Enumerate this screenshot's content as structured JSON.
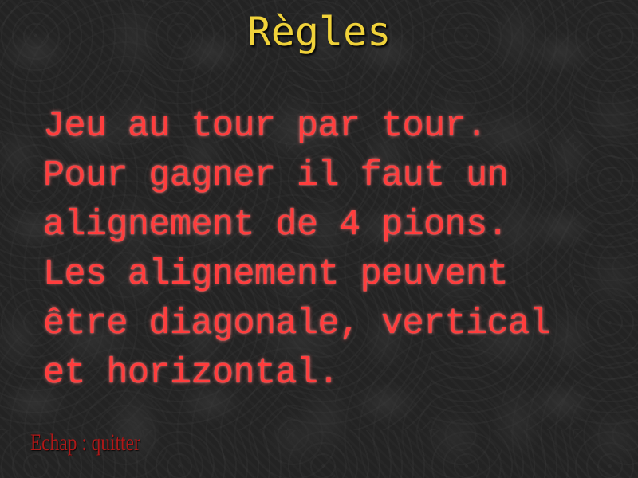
{
  "screen": {
    "title": "Règles",
    "lines": [
      "Jeu au tour par tour.",
      "Pour gagner il faut un",
      "alignement de 4 pions.",
      "Les alignement peuvent",
      "être diagonale, vertical",
      "et horizontal."
    ],
    "footer_hint": "Echap : quitter"
  },
  "colors": {
    "title": "#f0d23a",
    "rules_text": "#ff3d3d",
    "footer_text": "#b01818",
    "background": "#262626"
  }
}
